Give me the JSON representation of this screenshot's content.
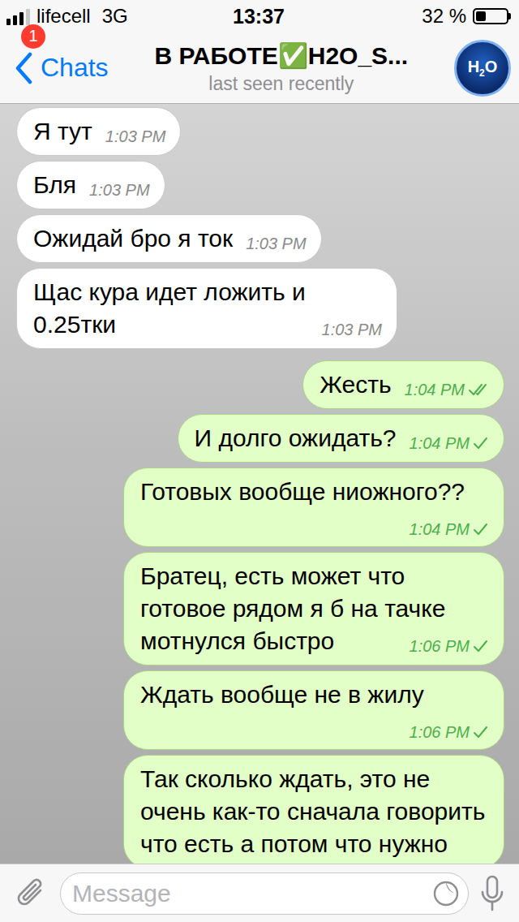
{
  "status_bar": {
    "carrier": "lifecell",
    "network": "3G",
    "time": "13:37",
    "battery": "32 %",
    "battery_level": 0.32,
    "signal_level": 0.75
  },
  "nav": {
    "back_label": "Chats",
    "unread_badge": "1",
    "title": "В РАБОТЕ✅H2O_S...",
    "subtitle": "last seen recently",
    "avatar": {
      "before": "H",
      "subscript": "2",
      "after": "O"
    }
  },
  "messages": [
    {
      "text": "Я тут",
      "time": "1:03 PM",
      "outgoing": false,
      "read": false
    },
    {
      "text": "Бля",
      "time": "1:03 PM",
      "outgoing": false,
      "read": false
    },
    {
      "text": "Ожидай бро я ток",
      "time": "1:03 PM",
      "outgoing": false,
      "read": false
    },
    {
      "text": "Щас кура идет ложить и 0.25тки",
      "time": "1:03 PM",
      "outgoing": false,
      "read": false
    },
    {
      "text": "Жесть",
      "time": "1:04 PM",
      "outgoing": true,
      "read": true
    },
    {
      "text": "И долго ожидать?",
      "time": "1:04 PM",
      "outgoing": true,
      "read": false
    },
    {
      "text": "Готовых вообще ниожного??",
      "time": "1:04 PM",
      "outgoing": true,
      "read": false
    },
    {
      "text": "Братец, есть может что готовое рядом я б на тачке мотнулся быстро",
      "time": "1:06 PM",
      "outgoing": true,
      "read": false
    },
    {
      "text": "Ждать вообще не в жилу",
      "time": "1:06 PM",
      "outgoing": true,
      "read": false
    },
    {
      "text": "Так сколько ждать, это не очень как-то сначала говорить что есть а потом что нужно",
      "time": "",
      "outgoing": true,
      "read": false
    }
  ],
  "composer": {
    "placeholder": "Message"
  }
}
